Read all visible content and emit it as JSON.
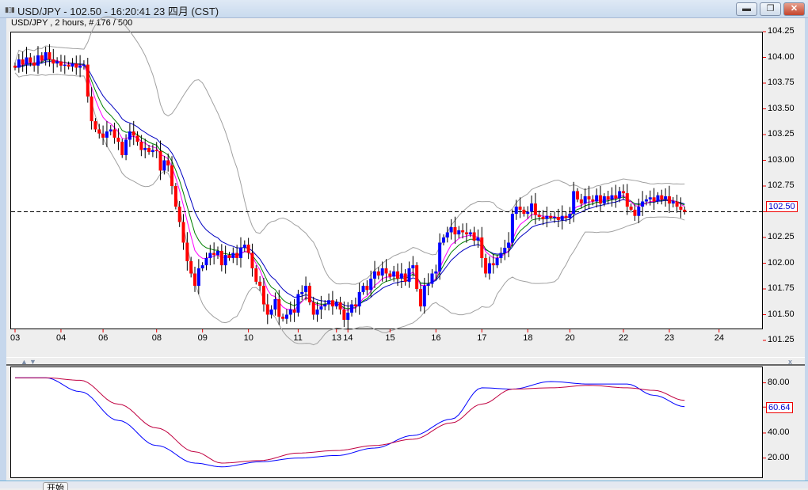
{
  "window": {
    "title": "USD/JPY - 102.50 - 16:20:41  23 四月 (CST)",
    "icon": "chart-bars-icon",
    "minimize": "minimize-icon",
    "restore": "restore-icon",
    "close": "close-icon"
  },
  "chart_header": "USD/JPY , 2 hours, # 176 / 500",
  "bottom_tab": "开始",
  "colors": {
    "bull": "#0000ff",
    "bear": "#ff0000",
    "ma_fast": "#ff00ff",
    "ma_mid": "#008000",
    "ma_slow": "#0000c0",
    "bands": "#a0a0a0",
    "osc_main": "#0000ff",
    "osc_signal": "#c00040",
    "price_line": "#0000c0"
  },
  "chart_data": [
    {
      "type": "candlestick",
      "symbol": "USD/JPY",
      "timeframe": "2 hours",
      "current_price": "102.50",
      "ylim": [
        101.25,
        104.25
      ],
      "y_ticks": [
        "104.25",
        "104.00",
        "103.75",
        "103.50",
        "103.25",
        "103.00",
        "102.75",
        "102.50",
        "102.25",
        "102.00",
        "101.75",
        "101.50",
        "101.25"
      ],
      "x_ticks": [
        {
          "label": "03",
          "bar": 0
        },
        {
          "label": "04",
          "bar": 12
        },
        {
          "label": "06",
          "bar": 23
        },
        {
          "label": "08",
          "bar": 37
        },
        {
          "label": "09",
          "bar": 49
        },
        {
          "label": "10",
          "bar": 61
        },
        {
          "label": "11",
          "bar": 74
        },
        {
          "label": "13",
          "bar": 84
        },
        {
          "label": "14",
          "bar": 87
        },
        {
          "label": "15",
          "bar": 98
        },
        {
          "label": "16",
          "bar": 110
        },
        {
          "label": "17",
          "bar": 122
        },
        {
          "label": "18",
          "bar": 134
        },
        {
          "label": "20",
          "bar": 145
        },
        {
          "label": "22",
          "bar": 159
        },
        {
          "label": "23",
          "bar": 171
        },
        {
          "label": "24",
          "bar": 184
        }
      ],
      "indicators": [
        "Bollinger Bands",
        "Moving Average (fast)",
        "Moving Average (medium)",
        "Moving Average (slow)"
      ],
      "close": [
        103.9,
        103.98,
        103.93,
        104.0,
        103.95,
        103.92,
        104.02,
        103.97,
        104.05,
        103.98,
        103.94,
        103.96,
        103.92,
        103.93,
        103.91,
        103.94,
        103.9,
        103.92,
        103.93,
        103.62,
        103.38,
        103.3,
        103.26,
        103.22,
        103.28,
        103.3,
        103.22,
        103.18,
        103.05,
        103.2,
        103.28,
        103.24,
        103.18,
        103.1,
        103.12,
        103.08,
        103.1,
        103.09,
        102.9,
        103.0,
        102.95,
        102.75,
        102.55,
        102.4,
        102.2,
        102.02,
        101.9,
        101.78,
        101.95,
        101.98,
        102.05,
        102.1,
        102.08,
        102.12,
        101.98,
        102.08,
        102.05,
        102.1,
        102.05,
        102.15,
        102.18,
        102.1,
        101.95,
        101.82,
        101.78,
        101.6,
        101.5,
        101.55,
        101.65,
        101.48,
        101.46,
        101.5,
        101.55,
        101.52,
        101.7,
        101.72,
        101.78,
        101.62,
        101.5,
        101.55,
        101.58,
        101.6,
        101.64,
        101.58,
        101.62,
        101.55,
        101.45,
        101.52,
        101.6,
        101.58,
        101.72,
        101.78,
        101.74,
        101.85,
        101.92,
        101.88,
        101.95,
        101.9,
        101.87,
        101.92,
        101.85,
        101.9,
        101.82,
        101.95,
        101.98,
        101.75,
        101.58,
        101.78,
        101.8,
        101.9,
        101.92,
        102.2,
        102.25,
        102.3,
        102.35,
        102.28,
        102.32,
        102.3,
        102.28,
        102.3,
        102.22,
        102.25,
        102.05,
        101.9,
        102.0,
        101.98,
        102.05,
        102.1,
        102.15,
        102.2,
        102.48,
        102.55,
        102.52,
        102.48,
        102.5,
        102.58,
        102.47,
        102.45,
        102.43,
        102.46,
        102.44,
        102.45,
        102.42,
        102.46,
        102.44,
        102.48,
        102.7,
        102.62,
        102.58,
        102.65,
        102.62,
        102.6,
        102.66,
        102.58,
        102.65,
        102.62,
        102.66,
        102.63,
        102.7,
        102.68,
        102.55,
        102.52,
        102.46,
        102.55,
        102.6,
        102.62,
        102.64,
        102.6,
        102.66,
        102.62,
        102.65,
        102.58,
        102.6,
        102.55,
        102.52,
        102.5
      ]
    },
    {
      "type": "line",
      "ylim": [
        4,
        93
      ],
      "y_ticks": [
        "80.00",
        "40.00",
        "20.00"
      ],
      "current_value": "60.64",
      "series": [
        {
          "bars": [
            0,
            8,
            17,
            27,
            37,
            47,
            54,
            64,
            74,
            84,
            94,
            104,
            114,
            122,
            130,
            140,
            150,
            160,
            167,
            175
          ],
          "values": [
            84,
            84,
            73,
            50,
            30,
            16,
            13,
            17,
            20,
            22,
            28,
            38,
            51,
            76,
            75,
            81,
            79,
            79,
            70,
            61
          ]
        },
        {
          "bars": [
            0,
            8,
            17,
            27,
            37,
            47,
            54,
            64,
            74,
            84,
            94,
            104,
            114,
            122,
            130,
            140,
            150,
            160,
            167,
            175
          ],
          "values": [
            84,
            84,
            82,
            63,
            44,
            25,
            16,
            18,
            24,
            26,
            30,
            35,
            48,
            63,
            75,
            76,
            78,
            76,
            74,
            66
          ]
        }
      ]
    }
  ]
}
